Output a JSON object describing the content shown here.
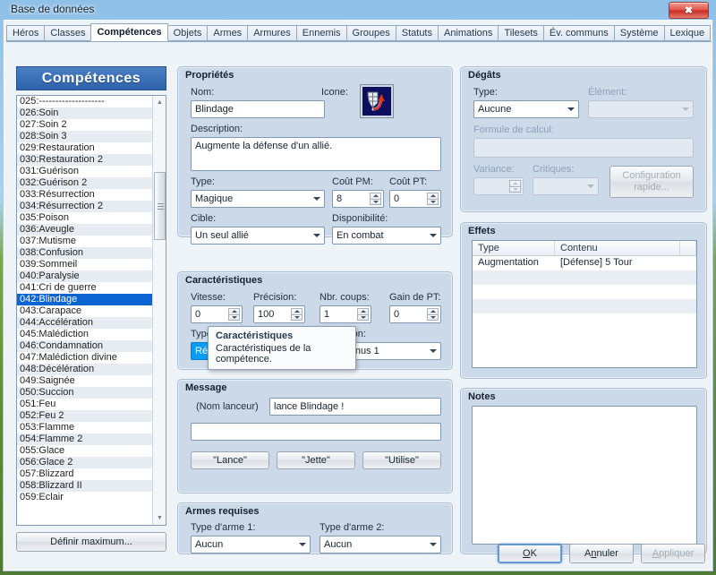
{
  "window": {
    "title": "Base de données",
    "close_label": "✖"
  },
  "tabs": [
    {
      "label": "Héros",
      "active": false
    },
    {
      "label": "Classes",
      "active": false
    },
    {
      "label": "Compétences",
      "active": true
    },
    {
      "label": "Objets",
      "active": false
    },
    {
      "label": "Armes",
      "active": false
    },
    {
      "label": "Armures",
      "active": false
    },
    {
      "label": "Ennemis",
      "active": false
    },
    {
      "label": "Groupes",
      "active": false
    },
    {
      "label": "Statuts",
      "active": false
    },
    {
      "label": "Animations",
      "active": false
    },
    {
      "label": "Tilesets",
      "active": false
    },
    {
      "label": "Év. communs",
      "active": false
    },
    {
      "label": "Système",
      "active": false
    },
    {
      "label": "Lexique",
      "active": false
    }
  ],
  "list": {
    "header": "Compétences",
    "define_max_label": "Définir maximum...",
    "selected_index": 17,
    "items": [
      "025:--------------------",
      "026:Soin",
      "027:Soin 2",
      "028:Soin 3",
      "029:Restauration",
      "030:Restauration 2",
      "031:Guérison",
      "032:Guérison 2",
      "033:Résurrection",
      "034:Résurrection 2",
      "035:Poison",
      "036:Aveugle",
      "037:Mutisme",
      "038:Confusion",
      "039:Sommeil",
      "040:Paralysie",
      "041:Cri de guerre",
      "042:Blindage",
      "043:Carapace",
      "044:Accélération",
      "045:Malédiction",
      "046:Condamnation",
      "047:Malédiction divine",
      "048:Décélération",
      "049:Saignée",
      "050:Succion",
      "051:Feu",
      "052:Feu 2",
      "053:Flamme",
      "054:Flamme 2",
      "055:Glace",
      "056:Glace 2",
      "057:Blizzard",
      "058:Blizzard II",
      "059:Eclair"
    ]
  },
  "properties": {
    "title": "Propriétés",
    "name_label": "Nom:",
    "name_value": "Blindage",
    "icon_label": "Icone:",
    "description_label": "Description:",
    "description_value": "Augmente la défense d'un allié.",
    "type_label": "Type:",
    "type_value": "Magique",
    "mp_cost_label": "Coût PM:",
    "mp_cost_value": "8",
    "tp_cost_label": "Coût PT:",
    "tp_cost_value": "0",
    "target_label": "Cible:",
    "target_value": "Un seul allié",
    "availability_label": "Disponibilité:",
    "availability_value": "En combat"
  },
  "characteristics": {
    "title": "Caractéristiques",
    "speed_label": "Vitesse:",
    "speed_value": "0",
    "precision_label": "Précision:",
    "precision_value": "100",
    "hits_label": "Nbr. coups:",
    "hits_value": "1",
    "tp_gain_label": "Gain de PT:",
    "tp_gain_value": "0",
    "attack_type_label": "Type d'attaque:",
    "attack_type_value": "Réussite garantie",
    "animation_label": "Animation:",
    "animation_value": "043:Bonus 1"
  },
  "tooltip": {
    "title": "Caractéristiques",
    "body": "Caractéristiques de la compétence."
  },
  "message": {
    "title": "Message",
    "caster_label": "(Nom lanceur)",
    "line1_value": "lance Blindage !",
    "line2_value": "",
    "buttons": [
      "\"Lance\"",
      "\"Jette\"",
      "\"Utilise\""
    ]
  },
  "weapons": {
    "title": "Armes requises",
    "weapon1_label": "Type d'arme 1:",
    "weapon1_value": "Aucun",
    "weapon2_label": "Type d'arme 2:",
    "weapon2_value": "Aucun"
  },
  "damage": {
    "title": "Dégâts",
    "type_label": "Type:",
    "type_value": "Aucune",
    "element_label": "Élément:",
    "element_value": "",
    "formula_label": "Formule de calcul:",
    "formula_value": "",
    "variance_label": "Variance:",
    "variance_value": "",
    "critical_label": "Critiques:",
    "critical_value": "",
    "quick_config_label": "Configuration rapide..."
  },
  "effects": {
    "title": "Effets",
    "columns": [
      "Type",
      "Contenu"
    ],
    "rows": [
      {
        "type": "Augmentation",
        "content": "[Défense] 5 Tour"
      }
    ],
    "empty_rows": 4
  },
  "notes": {
    "title": "Notes",
    "value": ""
  },
  "footer": {
    "ok": "OK",
    "ok_accel": "O",
    "cancel": "Annuler",
    "cancel_accel": "n",
    "apply": "Appliquer",
    "apply_accel": "A"
  },
  "colors": {
    "accent": "#0a64d2",
    "panel": "#ccd9e8",
    "header_blue": "#2f62ab",
    "focus_combo": "#0a9cf5"
  }
}
